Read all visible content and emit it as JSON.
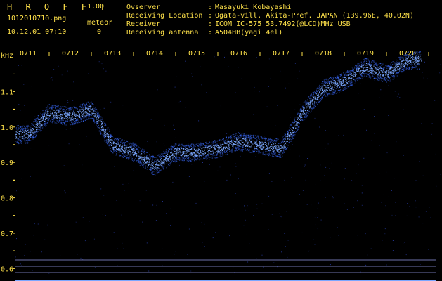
{
  "header": {
    "app_title": "H R O F F T",
    "version": "1.00",
    "filename": "1012010710.png",
    "datetime": "10.12.01 07:10",
    "meteor_label": "meteor",
    "meteor_count": "0",
    "info": [
      {
        "label": "Ovserver",
        "sep": ":",
        "value": "Masayuki Kobayashi"
      },
      {
        "label": "Receiving Location",
        "sep": ":",
        "value": "Ogata-vill. Akita-Pref. JAPAN (139.96E, 40.02N)"
      },
      {
        "label": "Receiver",
        "sep": ":",
        "value": "ICOM IC-575 53.7492(@LCD)MHz USB"
      },
      {
        "label": "Receiving antenna",
        "sep": ":",
        "value": "A504HB(yagi 4el)"
      }
    ]
  },
  "chart_data": {
    "type": "heatmap",
    "ylabel": "kHz",
    "x_ticks": [
      "0711",
      "0712",
      "0713",
      "0714",
      "0715",
      "0716",
      "0717",
      "0718",
      "0719",
      "0720"
    ],
    "y_ticks": [
      "1.1",
      "1.0",
      "0.9",
      "0.8",
      "0.7",
      "0.6"
    ],
    "ylim": [
      0.585,
      1.2
    ],
    "trace_time_minutes": [
      0.0,
      0.5,
      1.0,
      1.5,
      2.0,
      2.5,
      3.0,
      3.5,
      4.0,
      4.5,
      5.0,
      5.5,
      6.0,
      6.5,
      7.0,
      7.5,
      8.0,
      8.5,
      9.0
    ],
    "trace_freq_khz": [
      0.98,
      1.04,
      1.03,
      1.05,
      0.95,
      0.93,
      0.89,
      0.93,
      0.93,
      0.94,
      0.96,
      0.95,
      0.94,
      1.04,
      1.11,
      1.13,
      1.17,
      1.15,
      1.19
    ]
  },
  "colors": {
    "header_text": "#ffe24a",
    "axis_text": "#ffe24a",
    "grid_dots": "#3b5cff",
    "trace": "#3a6bff",
    "trace_core": "#7aa6ff",
    "baseline": "#8a8fd6"
  }
}
